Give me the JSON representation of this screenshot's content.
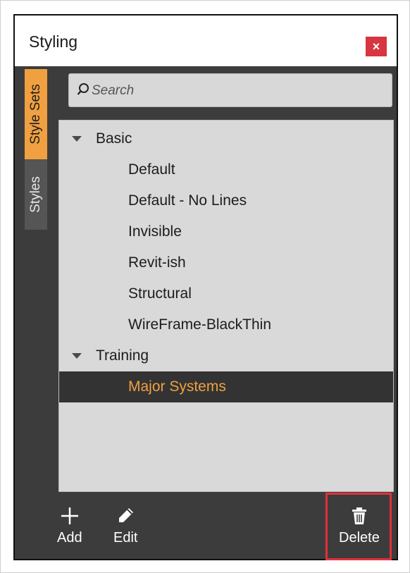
{
  "window": {
    "title": "Styling",
    "close_label": "×"
  },
  "tabs": [
    {
      "label": "Style Sets",
      "active": true
    },
    {
      "label": "Styles",
      "active": false
    }
  ],
  "search": {
    "placeholder": "Search",
    "value": ""
  },
  "tree": {
    "groups": [
      {
        "label": "Basic",
        "expanded": true,
        "items": [
          "Default",
          "Default - No Lines",
          "Invisible",
          "Revit-ish",
          "Structural",
          "WireFrame-BlackThin"
        ]
      },
      {
        "label": "Training",
        "expanded": true,
        "items": [
          "Major Systems"
        ]
      }
    ],
    "selected_item": "Major Systems"
  },
  "toolbar": {
    "add_label": "Add",
    "edit_label": "Edit",
    "delete_label": "Delete"
  },
  "colors": {
    "accent": "#f0a040",
    "panel_bg": "#3c3c3c",
    "list_bg": "#d9d9d9",
    "close_red": "#d7353f",
    "highlight_red": "#e0303a"
  }
}
